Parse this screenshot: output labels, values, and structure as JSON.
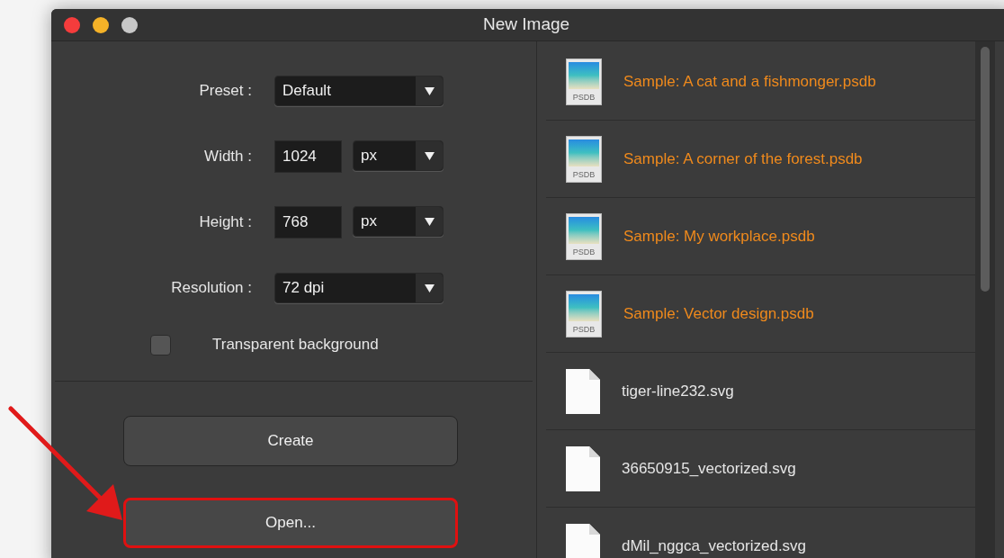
{
  "window": {
    "title": "New Image"
  },
  "form": {
    "fields": [
      {
        "kind": "select",
        "label": "Preset :",
        "value": "Default"
      },
      {
        "kind": "size",
        "label": "Width :",
        "value": "1024",
        "unit": "px"
      },
      {
        "kind": "size",
        "label": "Height :",
        "value": "768",
        "unit": "px"
      },
      {
        "kind": "select",
        "label": "Resolution :",
        "value": "72 dpi"
      }
    ],
    "checkbox": {
      "label": "Transparent background",
      "checked": false
    }
  },
  "buttons": [
    {
      "label": "Create",
      "highlighted": false
    },
    {
      "label": "Open...",
      "highlighted": true
    }
  ],
  "files": [
    {
      "kind": "sample",
      "name": "Sample: A cat and a fishmonger.psdb",
      "badge": "PSDB"
    },
    {
      "kind": "sample",
      "name": "Sample: A corner of the forest.psdb",
      "badge": "PSDB"
    },
    {
      "kind": "sample",
      "name": "Sample: My workplace.psdb",
      "badge": "PSDB"
    },
    {
      "kind": "sample",
      "name": "Sample: Vector design.psdb",
      "badge": "PSDB"
    },
    {
      "kind": "svg",
      "name": "tiger-line232.svg"
    },
    {
      "kind": "svg",
      "name": "36650915_vectorized.svg"
    },
    {
      "kind": "svg",
      "name": "dMil_nggca_vectorized.svg"
    }
  ]
}
